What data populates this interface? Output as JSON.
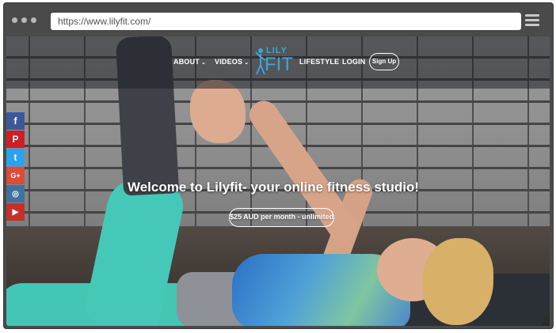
{
  "browser": {
    "url": "https://www.lilyfit.com/"
  },
  "nav": {
    "about": "ABOUT",
    "videos": "VIDEOS",
    "lifestyle": "LIFESTYLE",
    "login": "LOGIN",
    "signup": "Sign Up",
    "logo_top": "LILY",
    "logo_bottom": "FIT"
  },
  "social": [
    {
      "icon": "facebook-icon",
      "glyph": "f",
      "color": "#3b5998"
    },
    {
      "icon": "pinterest-icon",
      "glyph": "P",
      "color": "#cb2027"
    },
    {
      "icon": "twitter-icon",
      "glyph": "t",
      "color": "#2aa3ef"
    },
    {
      "icon": "google-plus-icon",
      "glyph": "G+",
      "color": "#dd4b39"
    },
    {
      "icon": "instagram-icon",
      "glyph": "◎",
      "color": "#3f729b"
    },
    {
      "icon": "youtube-icon",
      "glyph": "▶",
      "color": "#c4302b"
    }
  ],
  "hero": {
    "title": "Welcome to Lilyfit- your online fitness studio!",
    "cta": "$25 AUD per month - unlimited"
  },
  "colors": {
    "brand": "#3aa6d8"
  }
}
